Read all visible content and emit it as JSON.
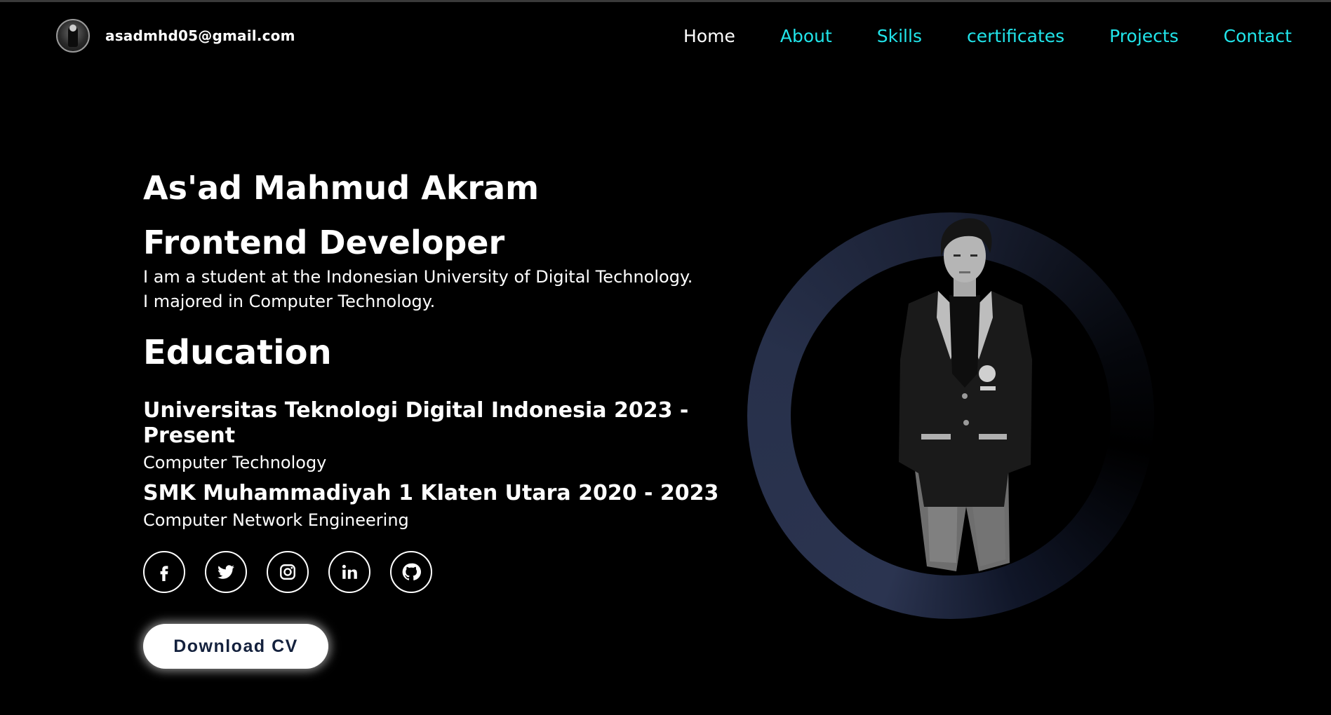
{
  "header": {
    "email": "asadmhd05@gmail.com",
    "nav": [
      {
        "label": "Home",
        "active": true
      },
      {
        "label": "About",
        "active": false
      },
      {
        "label": "Skills",
        "active": false
      },
      {
        "label": "certificates",
        "active": false
      },
      {
        "label": "Projects",
        "active": false
      },
      {
        "label": "Contact",
        "active": false
      }
    ]
  },
  "hero": {
    "name": "As'ad Mahmud Akram",
    "role": "Frontend Developer",
    "description_line1": "I am a student at the Indonesian University of Digital Technology.",
    "description_line2": "I majored in Computer Technology."
  },
  "education": {
    "heading": "Education",
    "items": [
      {
        "school": "Universitas Teknologi Digital Indonesia 2023 - Present",
        "major": "Computer Technology"
      },
      {
        "school": "SMK Muhammadiyah 1 Klaten Utara 2020 - 2023",
        "major": "Computer Network Engineering"
      }
    ]
  },
  "socials": [
    {
      "icon": "facebook-icon"
    },
    {
      "icon": "twitter-icon"
    },
    {
      "icon": "instagram-icon"
    },
    {
      "icon": "linkedin-icon"
    },
    {
      "icon": "github-icon"
    }
  ],
  "cta": {
    "download_cv_label": "Download CV"
  },
  "colors": {
    "background": "#000000",
    "accent": "#21e4ea",
    "text": "#ffffff",
    "button_text": "#14213d",
    "ring": "#2b3450"
  }
}
